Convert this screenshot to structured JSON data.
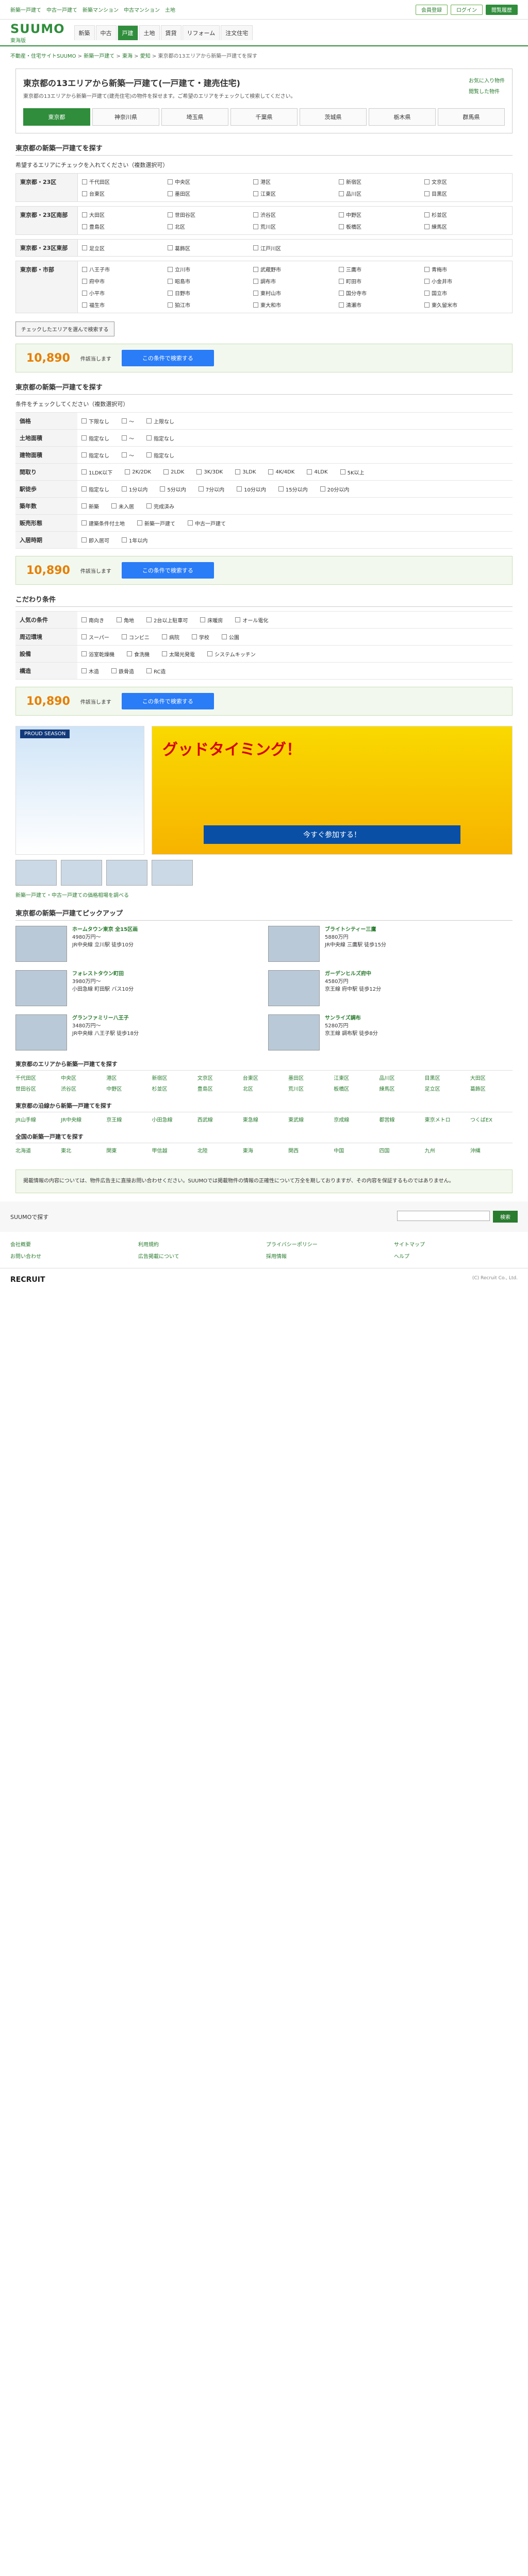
{
  "top_links": [
    "新築一戸建て",
    "中古一戸建て",
    "新築マンション",
    "中古マンション",
    "土地"
  ],
  "top_buttons": {
    "member": "会員登録",
    "login": "ログイン",
    "history": "閲覧履歴"
  },
  "logo": {
    "text": "SUUMO",
    "sub": "東海版"
  },
  "gnav": [
    "新築",
    "中古",
    "戸建",
    "土地",
    "賃貸",
    "リフォーム",
    "注文住宅"
  ],
  "breadcrumb": [
    "不動産・住宅サイトSUUMO",
    "新築一戸建て",
    "東海",
    "愛知",
    "東京都の13エリアから新築一戸建てを探す"
  ],
  "title": "東京都の13エリアから新築一戸建て(一戸建て・建売住宅)",
  "lead": "東京都の13エリアから新築一戸建て(建売住宅)の物件を探せます。ご希望のエリアをチェックして検索してください。",
  "side_links": [
    "お気に入り物件",
    "閲覧した物件"
  ],
  "tabs": [
    "東京都",
    "神奈川県",
    "埼玉県",
    "千葉県",
    "茨城県",
    "栃木県",
    "群馬県"
  ],
  "area_section": {
    "heading": "東京都の新築一戸建てを探す",
    "sub": "希望するエリアにチェックを入れてください（複数選択可）",
    "regions": [
      {
        "name": "東京都・23区",
        "items": [
          "千代田区",
          "中央区",
          "港区",
          "新宿区",
          "文京区",
          "台東区",
          "墨田区",
          "江東区",
          "品川区",
          "目黒区"
        ]
      },
      {
        "name": "東京都・23区南部",
        "items": [
          "大田区",
          "世田谷区",
          "渋谷区",
          "中野区",
          "杉並区",
          "豊島区",
          "北区",
          "荒川区",
          "板橋区",
          "練馬区"
        ]
      },
      {
        "name": "東京都・23区東部",
        "items": [
          "足立区",
          "葛飾区",
          "江戸川区"
        ]
      },
      {
        "name": "東京都・市部",
        "items": [
          "八王子市",
          "立川市",
          "武蔵野市",
          "三鷹市",
          "青梅市",
          "府中市",
          "昭島市",
          "調布市",
          "町田市",
          "小金井市",
          "小平市",
          "日野市",
          "東村山市",
          "国分寺市",
          "国立市",
          "福生市",
          "狛江市",
          "東大和市",
          "清瀬市",
          "東久留米市"
        ]
      }
    ]
  },
  "note_button": "チェックしたエリアを選んで検索する",
  "result": {
    "count": "10,890",
    "unit": "件該当します",
    "button": "この条件で検索する"
  },
  "cond_section": {
    "heading": "東京都の新築一戸建てを探す",
    "sub": "条件をチェックしてください（複数選択可）",
    "rows": [
      {
        "label": "価格",
        "values": [
          "下限なし",
          "〜",
          "上限なし"
        ]
      },
      {
        "label": "土地面積",
        "values": [
          "指定なし",
          "〜",
          "指定なし"
        ]
      },
      {
        "label": "建物面積",
        "values": [
          "指定なし",
          "〜",
          "指定なし"
        ]
      },
      {
        "label": "間取り",
        "values": [
          "1LDK以下",
          "2K/2DK",
          "2LDK",
          "3K/3DK",
          "3LDK",
          "4K/4DK",
          "4LDK",
          "5K以上"
        ]
      },
      {
        "label": "駅徒歩",
        "values": [
          "指定なし",
          "1分以内",
          "5分以内",
          "7分以内",
          "10分以内",
          "15分以内",
          "20分以内"
        ]
      },
      {
        "label": "築年数",
        "values": [
          "新築",
          "未入居",
          "完成済み"
        ]
      },
      {
        "label": "販売形態",
        "values": [
          "建築条件付土地",
          "新築一戸建て",
          "中古一戸建て"
        ]
      },
      {
        "label": "入居時期",
        "values": [
          "即入居可",
          "1年以内"
        ]
      }
    ]
  },
  "detail_section": {
    "heading": "こだわり条件",
    "rows": [
      {
        "label": "人気の条件",
        "values": [
          "南向き",
          "角地",
          "2台以上駐車可",
          "床暖房",
          "オール電化"
        ]
      },
      {
        "label": "周辺環境",
        "values": [
          "スーパー",
          "コンビニ",
          "病院",
          "学校",
          "公園"
        ]
      },
      {
        "label": "設備",
        "values": [
          "浴室乾燥機",
          "食洗機",
          "太陽光発電",
          "システムキッチン"
        ]
      },
      {
        "label": "構造",
        "values": [
          "木造",
          "鉄骨造",
          "RC造"
        ]
      }
    ]
  },
  "banners": {
    "left": "PROUD SEASON",
    "right_title": "グッドタイミング！",
    "right_button": "今すぐ参加する！"
  },
  "ad_link": "新築一戸建て・中古一戸建ての価格相場を調べる",
  "listing_heading": "東京都の新築一戸建てピックアップ",
  "listings": [
    {
      "title": "ホームタウン東京 全15区画",
      "price": "4980万円〜",
      "access": "JR中央線 立川駅 徒歩10分"
    },
    {
      "title": "ブライトシティー三鷹",
      "price": "5880万円",
      "access": "JR中央線 三鷹駅 徒歩15分"
    },
    {
      "title": "フォレストタウン町田",
      "price": "3980万円〜",
      "access": "小田急線 町田駅 バス10分"
    },
    {
      "title": "ガーデンヒルズ府中",
      "price": "4580万円",
      "access": "京王線 府中駅 徒歩12分"
    },
    {
      "title": "グランファミリー八王子",
      "price": "3480万円〜",
      "access": "JR中央線 八王子駅 徒歩18分"
    },
    {
      "title": "サンライズ調布",
      "price": "5280万円",
      "access": "京王線 調布駅 徒歩8分"
    }
  ],
  "link_blocks": [
    {
      "heading": "東京都のエリアから新築一戸建てを探す",
      "links": [
        "千代田区",
        "中央区",
        "港区",
        "新宿区",
        "文京区",
        "台東区",
        "墨田区",
        "江東区",
        "品川区",
        "目黒区",
        "大田区",
        "世田谷区",
        "渋谷区",
        "中野区",
        "杉並区",
        "豊島区",
        "北区",
        "荒川区",
        "板橋区",
        "練馬区",
        "足立区",
        "葛飾区"
      ]
    },
    {
      "heading": "東京都の沿線から新築一戸建てを探す",
      "links": [
        "JR山手線",
        "JR中央線",
        "京王線",
        "小田急線",
        "西武線",
        "東急線",
        "東武線",
        "京成線",
        "都営線",
        "東京メトロ",
        "つくばEX"
      ]
    },
    {
      "heading": "全国の新築一戸建てを探す",
      "links": [
        "北海道",
        "東北",
        "関東",
        "甲信越",
        "北陸",
        "東海",
        "関西",
        "中国",
        "四国",
        "九州",
        "沖縄"
      ]
    }
  ],
  "footer_note": "掲載情報の内容については、物件広告主に直接お問い合わせください。SUUMOでは掲載物件の情報の正確性について万全を期しておりますが、その内容を保証するものではありません。",
  "footer_search": {
    "label": "SUUMOで探す",
    "placeholder": "",
    "button": "検索"
  },
  "footer_links": [
    "会社概要",
    "利用規約",
    "プライバシーポリシー",
    "サイトマップ",
    "お問い合わせ",
    "広告掲載について",
    "採用情報",
    "ヘルプ"
  ],
  "copyright": "(C) Recruit Co., Ltd.",
  "recruit": "RECRUIT"
}
